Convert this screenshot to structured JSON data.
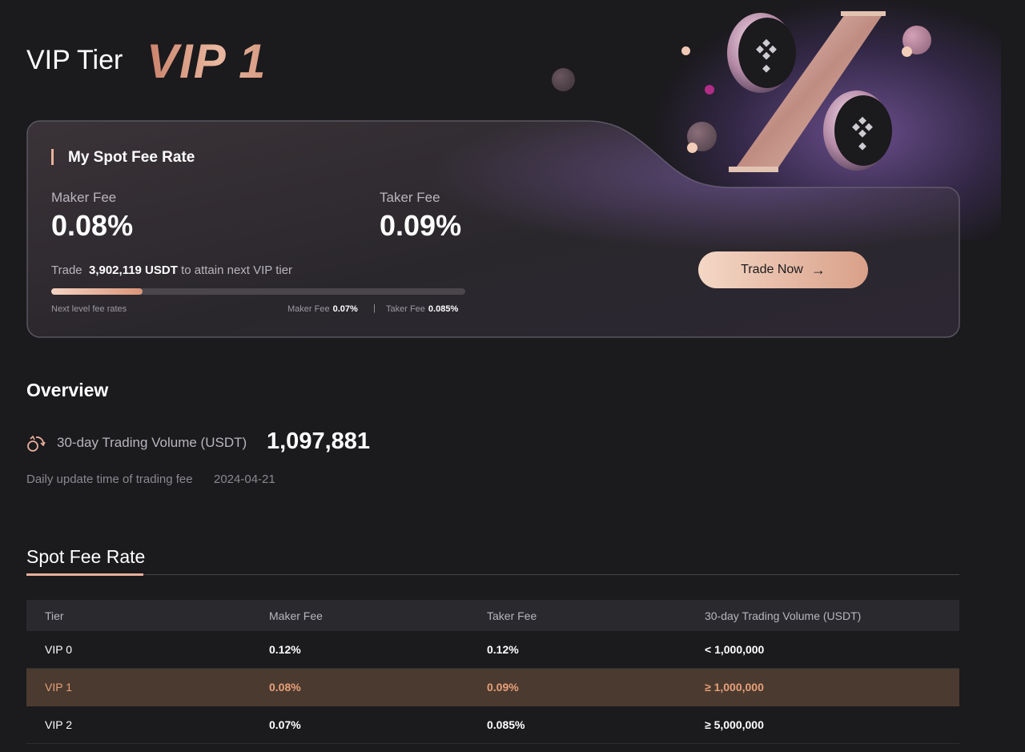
{
  "header": {
    "title": "VIP Tier",
    "tier": "VIP 1"
  },
  "fee_card": {
    "title": "My Spot Fee Rate",
    "maker_label": "Maker Fee",
    "maker_value": "0.08%",
    "taker_label": "Taker Fee",
    "taker_value": "0.09%",
    "trade_prefix": "Trade",
    "trade_amount": "3,902,119 USDT",
    "trade_suffix": "to attain next VIP tier",
    "progress_fraction": 0.22,
    "next_level_label": "Next level fee rates",
    "next_maker_label": "Maker Fee",
    "next_maker_value": "0.07%",
    "separator": "|",
    "next_taker_label": "Taker Fee",
    "next_taker_value": "0.085%",
    "button_label": "Trade Now",
    "button_icon": "arrow-right-icon"
  },
  "overview": {
    "title": "Overview",
    "volume_icon": "exchange-icon",
    "volume_label": "30-day Trading Volume (USDT)",
    "volume_value": "1,097,881",
    "update_label": "Daily update time of trading fee",
    "update_date": "2024-04-21"
  },
  "tabs": {
    "active": "Spot Fee Rate"
  },
  "table": {
    "headers": [
      "Tier",
      "Maker Fee",
      "Taker Fee",
      "30-day Trading Volume (USDT)"
    ],
    "rows": [
      [
        "VIP 0",
        "0.12%",
        "0.12%",
        "< 1,000,000"
      ],
      [
        "VIP 1",
        "0.08%",
        "0.09%",
        "≥ 1,000,000"
      ],
      [
        "VIP 2",
        "0.07%",
        "0.085%",
        "≥ 5,000,000"
      ]
    ],
    "highlight_row": 1
  },
  "colors": {
    "background": "#1b1a1d",
    "accent": "#e7b09b",
    "highlight_row": "#4b3a2f",
    "highlight_text": "#e7a07a"
  }
}
